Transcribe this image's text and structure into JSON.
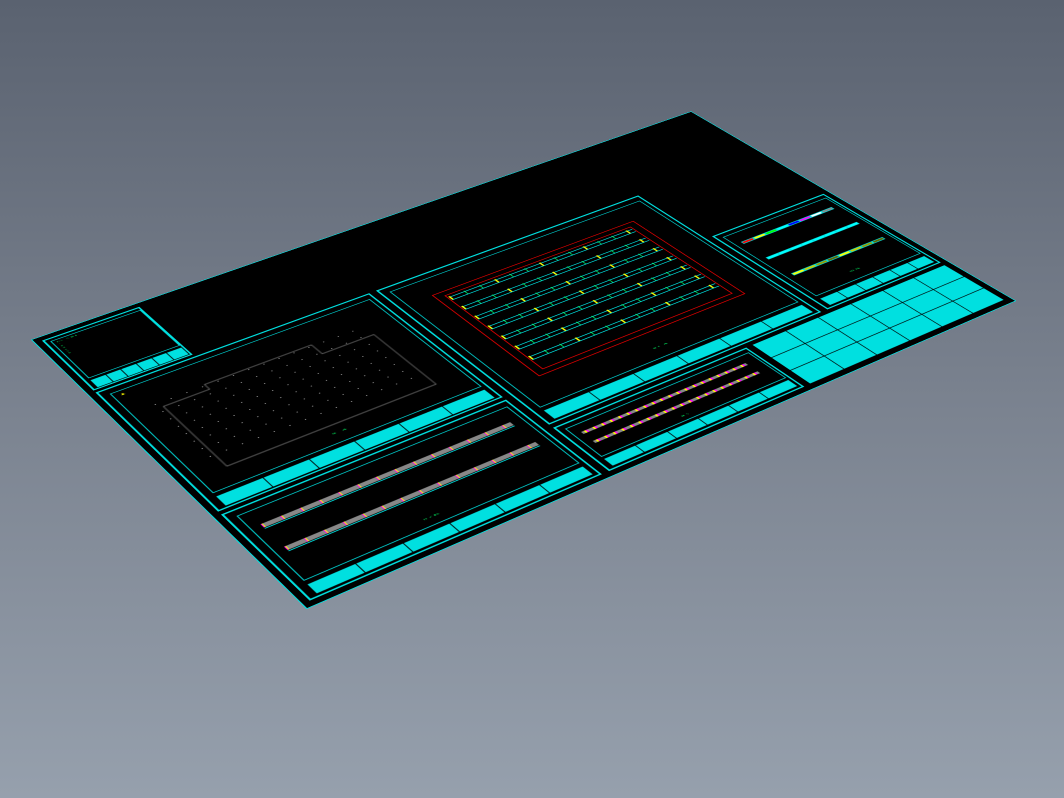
{
  "meta": {
    "view": "isometric",
    "theme": "cad-dark"
  },
  "colors": {
    "frame": "#00e0e0",
    "bg": "#000000",
    "green": "#00ff66",
    "yellow": "#ffff00",
    "red": "#ff0000",
    "magenta": "#ff00ff",
    "white": "#ffffff"
  },
  "panels": {
    "a": {
      "label": "notes",
      "title_lines": [
        "GENERAL NOTES",
        "1.",
        "2.",
        "3.",
        "4.",
        "5.",
        "6.",
        "7.",
        "8."
      ]
    },
    "b": {
      "label": "site-plan",
      "caption": "SITE PLAN"
    },
    "c": {
      "label": "elevations",
      "caption": "ELEVATION"
    },
    "d": {
      "label": "roof-plan",
      "caption": "ROOF PLAN"
    },
    "e": {
      "label": "details",
      "caption": "DETAIL"
    },
    "f": {
      "label": "sections",
      "caption": "SECTION"
    }
  },
  "site_plan": {
    "grid_cols": 14,
    "grid_rows": 8,
    "pin": "▲"
  },
  "roof_plan": {
    "rows": 7,
    "bays": 12
  },
  "color_strips": [
    [
      "#ff0000",
      "#ffff00",
      "#00ff00",
      "#00ffff",
      "#0000ff",
      "#ff00ff",
      "#ffffff",
      "#888888"
    ],
    [
      "#00ffff",
      "#00ffff",
      "#00ffff",
      "#00ffff",
      "#00ffff",
      "#00ffff",
      "#00ffff",
      "#00ffff"
    ],
    [
      "#ffff00",
      "#cccc00",
      "#999900",
      "#666600",
      "#ffff00",
      "#cccc00",
      "#999900",
      "#666600"
    ]
  ],
  "titleblock": {
    "cols": 6,
    "rows": 3
  }
}
